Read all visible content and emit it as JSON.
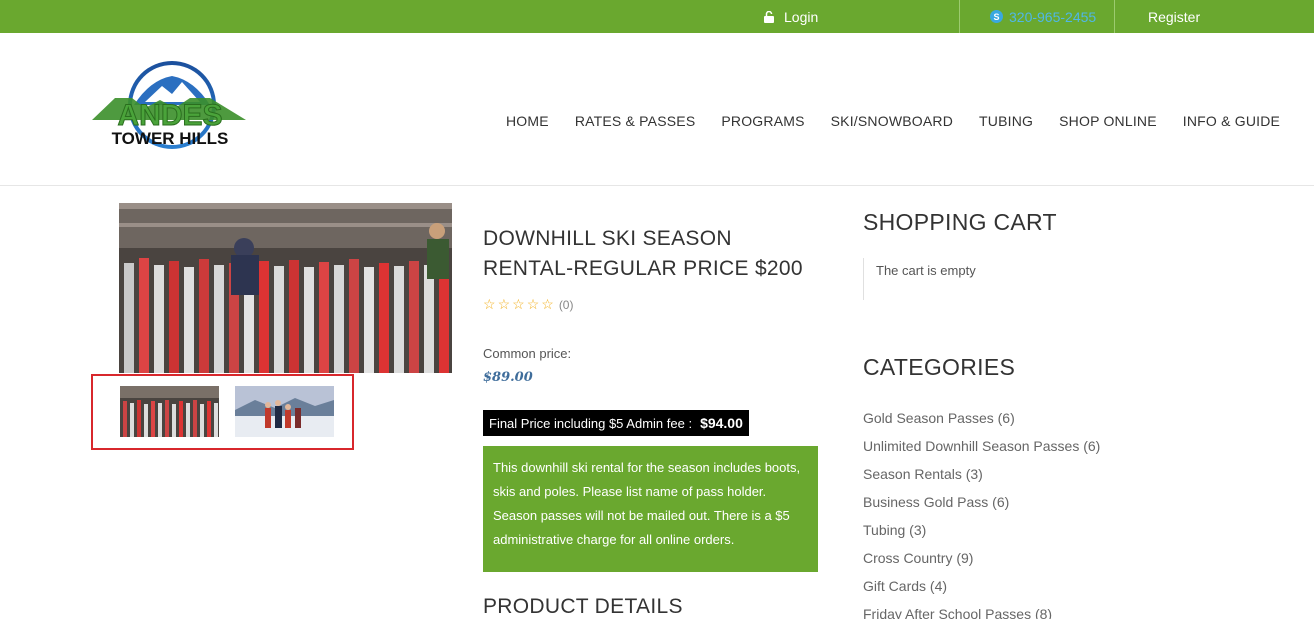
{
  "topbar": {
    "login": "Login",
    "phone": "320-965-2455",
    "register": "Register",
    "colors": {
      "bar": "#6aa82f",
      "phone": "#4fb7e6"
    }
  },
  "logo": {
    "line1": "ANDES",
    "line2": "TOWER HILLS"
  },
  "nav": [
    "HOME",
    "RATES & PASSES",
    "PROGRAMS",
    "SKI/SNOWBOARD",
    "TUBING",
    "SHOP ONLINE",
    "INFO & GUIDE"
  ],
  "product": {
    "title": "DOWNHILL SKI SEASON RENTAL-REGULAR PRICE $200",
    "rating_count": "(0)",
    "common_price_label": "Common price:",
    "common_price": "$89.00",
    "final_price_label": "Final Price including $5 Admin fee :",
    "final_price": "$94.00",
    "description": "This downhill ski rental for the season includes boots, skis and poles. Please list name of pass holder. Season passes will not be mailed out. There is a $5 administrative charge for all online orders.",
    "details_heading": "PRODUCT DETAILS"
  },
  "cart": {
    "title": "SHOPPING CART",
    "empty_text": "The cart is empty"
  },
  "categories": {
    "title": "CATEGORIES",
    "items": [
      "Gold Season Passes (6)",
      "Unlimited Downhill Season Passes (6)",
      "Season Rentals (3)",
      "Business Gold Pass (6)",
      "Tubing (3)",
      "Cross Country (9)",
      "Gift Cards (4)",
      "Friday After School Passes (8)"
    ]
  }
}
